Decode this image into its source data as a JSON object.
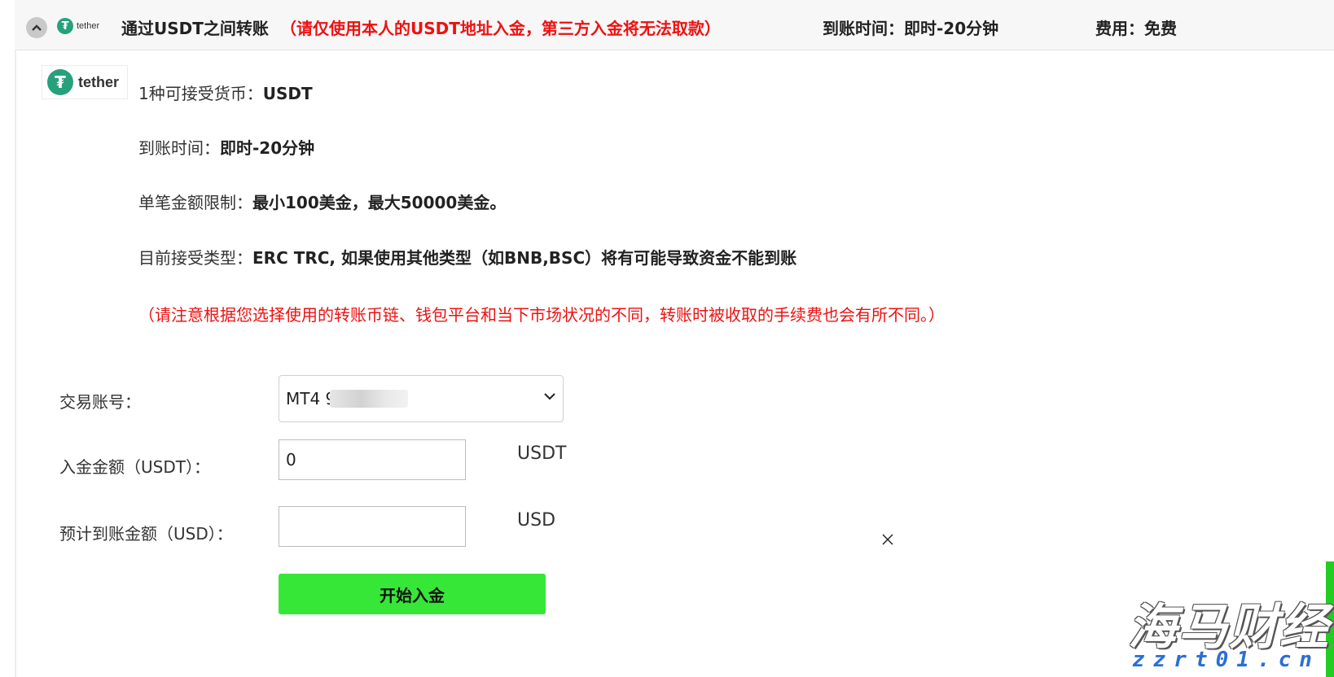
{
  "header": {
    "logo_text": "tether",
    "title": "通过USDT之间转账",
    "warning": "（请仅使用本人的USDT地址入金，第三方入金将无法取款）",
    "arrival_time": "到账时间：即时-20分钟",
    "fee": "费用：免费"
  },
  "info": {
    "logo_text": "tether",
    "currency_label": "1种可接受货币：",
    "currency_value": "USDT",
    "time_label": "到账时间：",
    "time_value": "即时-20分钟",
    "limit_label": "单笔金额限制：",
    "limit_value": "最小100美金，最大50000美金。",
    "type_label": "目前接受类型：",
    "type_value": "ERC TRC, 如果使用其他类型（如BNB,BSC）将有可能导致资金不能到账",
    "note": "（请注意根据您选择使用的转账币链、钱包平台和当下市场状况的不同，转账时被收取的手续费也会有所不同。）"
  },
  "form": {
    "account_label": "交易账号：",
    "account_value": "MT4 9",
    "amount_label": "入金金额（USDT）：",
    "amount_value": "0",
    "amount_unit": "USDT",
    "expected_label": "预计到账金额（USD）：",
    "expected_value": "",
    "expected_unit": "USD",
    "submit_label": "开始入金"
  },
  "watermark": {
    "main": "海马财经",
    "sub": "zzrt01.cn"
  },
  "colors": {
    "tether_green": "#26a17b",
    "warning_red": "#ee1111",
    "button_green": "#37e737"
  },
  "icons": {
    "collapse": "chevron-up-icon",
    "dropdown": "chevron-down-icon",
    "close": "close-icon"
  }
}
